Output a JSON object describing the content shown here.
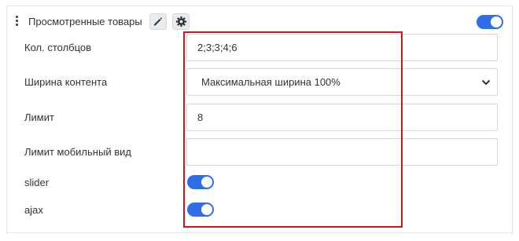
{
  "module": {
    "title": "Просмотренные товары",
    "enabled": true
  },
  "settings": [
    {
      "label": "Кол. столбцов",
      "type": "text",
      "value": "2;3;3;4;6"
    },
    {
      "label": "Ширина контента",
      "type": "select",
      "value": "Максимальная ширина 100%"
    },
    {
      "label": "Лимит",
      "type": "text",
      "value": "8"
    },
    {
      "label": "Лимит мобильный вид",
      "type": "text",
      "value": ""
    },
    {
      "label": "slider",
      "type": "toggle",
      "value": true
    },
    {
      "label": "ajax",
      "type": "toggle",
      "value": true
    }
  ],
  "colors": {
    "accent": "#2f6ee8",
    "highlight": "#d0161d"
  }
}
